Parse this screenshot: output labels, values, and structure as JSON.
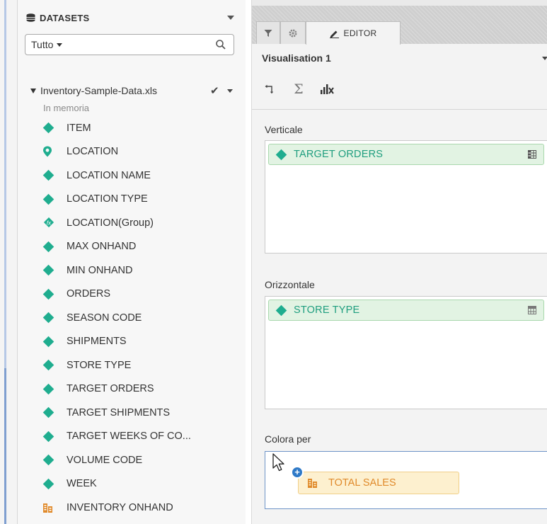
{
  "datasets": {
    "title": "DATASETS",
    "filter": {
      "selected": "Tutto"
    },
    "dataset": {
      "name": "Inventory-Sample-Data.xls",
      "status": "In memoria"
    },
    "fields": [
      {
        "label": "ITEM",
        "icon": "diamond-icon"
      },
      {
        "label": "LOCATION",
        "icon": "location-pin-icon"
      },
      {
        "label": "LOCATION NAME",
        "icon": "diamond-icon"
      },
      {
        "label": "LOCATION TYPE",
        "icon": "diamond-icon"
      },
      {
        "label": "LOCATION(Group)",
        "icon": "fx-diamond-icon"
      },
      {
        "label": "MAX ONHAND",
        "icon": "diamond-icon"
      },
      {
        "label": "MIN ONHAND",
        "icon": "diamond-icon"
      },
      {
        "label": "ORDERS",
        "icon": "diamond-icon"
      },
      {
        "label": "SEASON CODE",
        "icon": "diamond-icon"
      },
      {
        "label": "SHIPMENTS",
        "icon": "diamond-icon"
      },
      {
        "label": "STORE TYPE",
        "icon": "diamond-icon"
      },
      {
        "label": "TARGET ORDERS",
        "icon": "diamond-icon"
      },
      {
        "label": "TARGET SHIPMENTS",
        "icon": "diamond-icon"
      },
      {
        "label": "TARGET WEEKS OF CO...",
        "icon": "diamond-icon"
      },
      {
        "label": "VOLUME CODE",
        "icon": "diamond-icon"
      },
      {
        "label": "WEEK",
        "icon": "diamond-icon"
      },
      {
        "label": "INVENTORY ONHAND",
        "icon": "measure-icon"
      }
    ]
  },
  "editor": {
    "tabs": {
      "editor_label": "EDITOR"
    },
    "visualisation_title": "Visualisation 1",
    "sections": {
      "vertical": {
        "label": "Verticale",
        "item": "TARGET ORDERS"
      },
      "horizontal": {
        "label": "Orizzontale",
        "item": "STORE TYPE"
      },
      "color": {
        "label": "Colora per",
        "item": "TOTAL SALES"
      }
    }
  },
  "colors": {
    "dimension": "#1fad8f",
    "measure": "#e08a2b",
    "pill_green_bg": "#e2f3e3",
    "pill_orange_bg": "#fdf0cf",
    "accent_blue": "#2e79c7"
  }
}
